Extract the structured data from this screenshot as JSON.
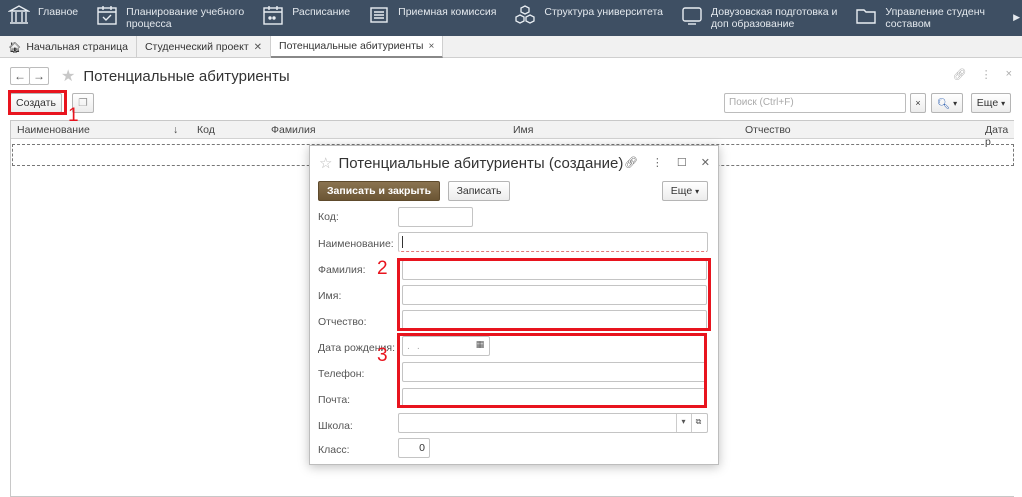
{
  "sections": [
    {
      "icon": "building-icon",
      "label_line1": "Главное",
      "label_line2": ""
    },
    {
      "icon": "calendar-check-icon",
      "label_line1": "Планирование учебного",
      "label_line2": "процесса"
    },
    {
      "icon": "calendar-icon",
      "label_line1": "Расписание",
      "label_line2": ""
    },
    {
      "icon": "list-icon",
      "label_line1": "Приемная комиссия",
      "label_line2": ""
    },
    {
      "icon": "cubes-icon",
      "label_line1": "Структура университета",
      "label_line2": ""
    },
    {
      "icon": "monitor-icon",
      "label_line1": "Довузовская подготовка и",
      "label_line2": "доп образование"
    },
    {
      "icon": "folder-icon",
      "label_line1": "Управление студенч",
      "label_line2": "составом"
    }
  ],
  "tabs": [
    {
      "label": "Начальная страница",
      "closable": false
    },
    {
      "label": "Студенческий проект",
      "closable": true
    },
    {
      "label": "Потенциальные абитуриенты",
      "closable": true,
      "active": true
    }
  ],
  "list": {
    "title": "Потенциальные абитуриенты",
    "create_label": "Создать",
    "search_placeholder": "Поиск (Ctrl+F)",
    "more_label": "Еще",
    "columns": [
      "Наименование",
      "Код",
      "Фамилия",
      "Имя",
      "Отчество",
      "Дата р"
    ],
    "sort_indicator": "↓"
  },
  "modal": {
    "title": "Потенциальные абитуриенты (создание)",
    "save_close_label": "Записать и закрыть",
    "save_label": "Записать",
    "more_label": "Еще",
    "fields": {
      "code": {
        "label": "Код:",
        "value": ""
      },
      "name": {
        "label": "Наименование:",
        "value": ""
      },
      "surname": {
        "label": "Фамилия:",
        "value": ""
      },
      "first_name": {
        "label": "Имя:",
        "value": ""
      },
      "patronymic": {
        "label": "Отчество:",
        "value": ""
      },
      "birth_date": {
        "label": "Дата рождения:",
        "value": ". ."
      },
      "phone": {
        "label": "Телефон:",
        "value": ""
      },
      "email": {
        "label": "Почта:",
        "value": ""
      },
      "school": {
        "label": "Школа:",
        "value": ""
      },
      "grade": {
        "label": "Класс:",
        "value": "0"
      }
    }
  },
  "annotations": [
    "1",
    "2",
    "3"
  ],
  "colors": {
    "highlight": "#e8141e",
    "topbar": "#3e4f63",
    "primary_button": "#7a6240"
  }
}
